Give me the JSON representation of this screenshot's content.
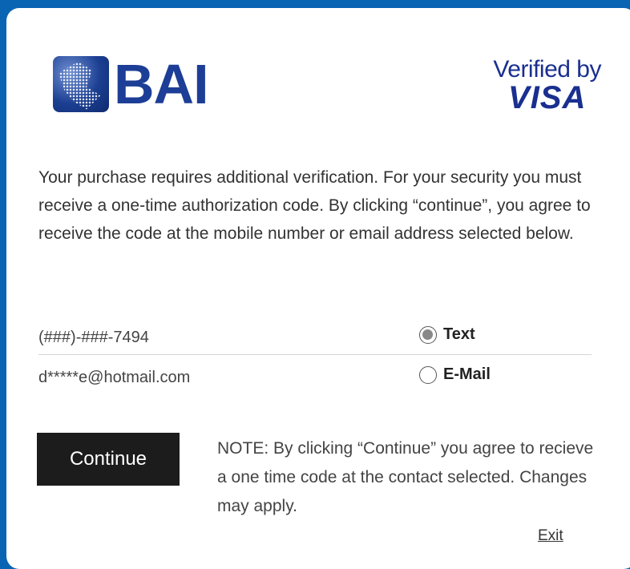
{
  "brand": {
    "bank_name": "BAI",
    "logo_icon": "globe-icon",
    "verified_line1": "Verified by",
    "verified_line2": "VISA",
    "colors": {
      "background": "#0a64b4",
      "brand_blue": "#1d3e96",
      "button": "#1c1c1c"
    }
  },
  "description": "Your purchase requires additional verification. For your security you must receive a one-time authorization code. By clicking “continue”, you agree to receive the code at the mobile number or email address selected below.",
  "contacts": [
    {
      "value": "(###)-###-7494",
      "option_label": "Text",
      "selected": true
    },
    {
      "value": "d*****e@hotmail.com",
      "option_label": "E-Mail",
      "selected": false
    }
  ],
  "actions": {
    "continue_label": "Continue",
    "exit_label": "Exit"
  },
  "note": "NOTE: By clicking “Continue” you agree to recieve a one time code at the contact selected. Changes may apply."
}
